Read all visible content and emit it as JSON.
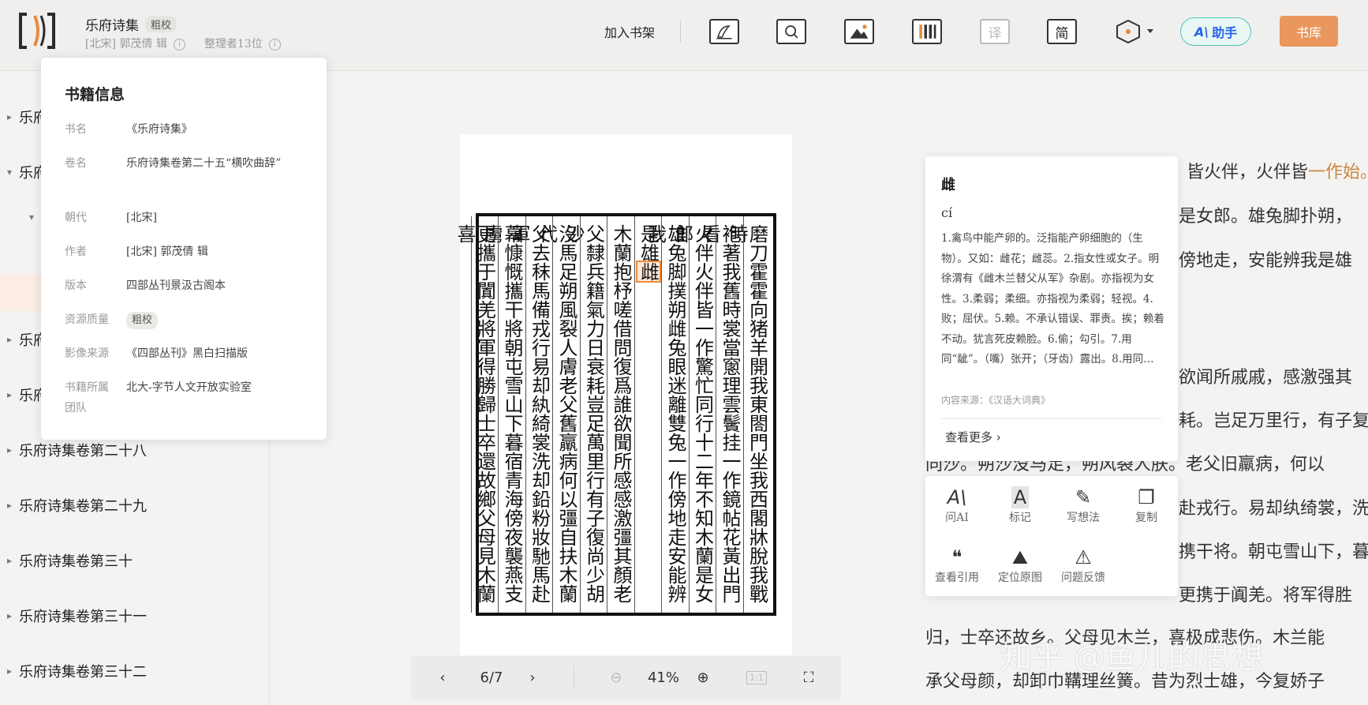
{
  "header": {
    "title": "乐府诗集",
    "quality_tag": "粗校",
    "author_line": "[北宋] 郭茂倩 辑",
    "editors": "整理者13位",
    "add_shelf": "加入书架",
    "zoom_icons": [
      "pen-icon",
      "search-icon",
      "image-icon",
      "columns-icon",
      "translate-icon",
      "simplified-icon",
      "theme-icon"
    ],
    "translate_label": "译",
    "simplified_label": "简",
    "ai_button": "助手",
    "library_button": "书库"
  },
  "toc": {
    "items": [
      {
        "label": "乐府"
      },
      {
        "label": "乐府"
      },
      {
        "label": "乐府"
      },
      {
        "label": "乐府"
      },
      {
        "label": "乐府诗集卷第二十八"
      },
      {
        "label": "乐府诗集卷第二十九"
      },
      {
        "label": "乐府诗集卷第三十"
      },
      {
        "label": "乐府诗集卷第三十一"
      },
      {
        "label": "乐府诗集卷第三十二"
      }
    ]
  },
  "book_info": {
    "heading": "书籍信息",
    "rows": [
      {
        "key": "书名",
        "value": "《乐府诗集》"
      },
      {
        "key": "卷名",
        "value": "乐府诗集卷第二十五“横吹曲辞”"
      },
      {
        "key": "朝代",
        "value": "[北宋]"
      },
      {
        "key": "作者",
        "value": "[北宋] 郭茂倩 辑"
      },
      {
        "key": "版本",
        "value": "四部丛刊景汲古阁本"
      },
      {
        "key": "资源质量",
        "value": "粗校"
      },
      {
        "key": "影像来源",
        "value": "《四部丛刊》黑白扫描版"
      },
      {
        "key": "书籍所属团队",
        "value": "北大-字节人文开放实验室"
      }
    ]
  },
  "scan": {
    "columns": [
      "磨刀霍霍向猪羊開我東閤門坐我西閣牀脫我戰時",
      "袍著我舊時裳當窻理雲鬢挂一作鏡帖花黃出門看",
      "火伴火伴皆一作驚忙同行十二年不知木蘭是女郎",
      "雄兔脚撲朔雌兔眼迷離雙兔一作傍地走安能辨我",
      "是雄雌",
      "木蘭抱杼嗟借問復爲誰欲聞所感感激彊其顏老",
      "父隸兵籍氣力日衰耗豈足萬里行有子復尚少胡沙",
      "沒馬足朔風裂人膚老父舊羸病何以彊自扶木蘭代",
      "父去秣馬備戎行易却紈綺裳洗却鉛粉妝馳馬赴軍",
      "幕慷慨攜干將朝屯雪山下暮宿青海傍夜襲燕支虜",
      "更攜于闐羌將軍得勝歸士卒還故鄉父母見木蘭喜"
    ]
  },
  "page_toolbar": {
    "page": "6/7",
    "zoom": "41%",
    "ratio": "1:1"
  },
  "reading_text": {
    "line1_a": "皆火伴，火伴皆",
    "line1_b": "一作始。",
    "line2": "是女郎。雄兔脚扑朔，",
    "line3": "傍地走，安能辨我是雄",
    "line4": "欲闻所戚戚，感激强其",
    "line5": "耗。岂足万里行，有子复",
    "line6": "同沙。朔沙没马足，朔风裂人肤。老父旧羸病，何以",
    "line7": "赴戎行。易却纨绮裳，洗",
    "line8": "携干将。朝屯雪山下，暮",
    "line9": "更携于阗羌。将军得胜",
    "line10": "归，士卒还故乡。父母见木兰，喜极成悲伤。木兰能",
    "line11": "承父母颜，却卸巾鞲理丝簧。昔为烈士雄，今复娇子"
  },
  "dictionary": {
    "word": "雌",
    "pinyin": "cí",
    "definition": "1.禽鸟中能产卵的。泛指能产卵细胞的（生物）。又如：雌花；雌蕊。2.指女性或女子。明徐渭有《雌木兰替父从军》杂剧。亦指视为女性。3.柔弱；柔细。亦指视为柔弱；轻视。4.败；屈伏。5.赖。不承认错误、罪责。挨；赖着不动。犹言死皮赖脸。6.偷；勾引。7.用同“龇”。（嘴）张开；（牙齿）露出。8.用同…",
    "source": "内容来源：《汉语大词典》",
    "more": "查看更多"
  },
  "actions": [
    {
      "label": "问AI",
      "icon": "ai-icon"
    },
    {
      "label": "标记",
      "icon": "mark-icon"
    },
    {
      "label": "写想法",
      "icon": "pen-icon"
    },
    {
      "label": "复制",
      "icon": "copy-icon"
    },
    {
      "label": "查看引用",
      "icon": "quote-icon"
    },
    {
      "label": "定位原图",
      "icon": "locate-image-icon"
    },
    {
      "label": "问题反馈",
      "icon": "feedback-icon"
    }
  ],
  "watermark": "知乎 @鱼儿的思想"
}
